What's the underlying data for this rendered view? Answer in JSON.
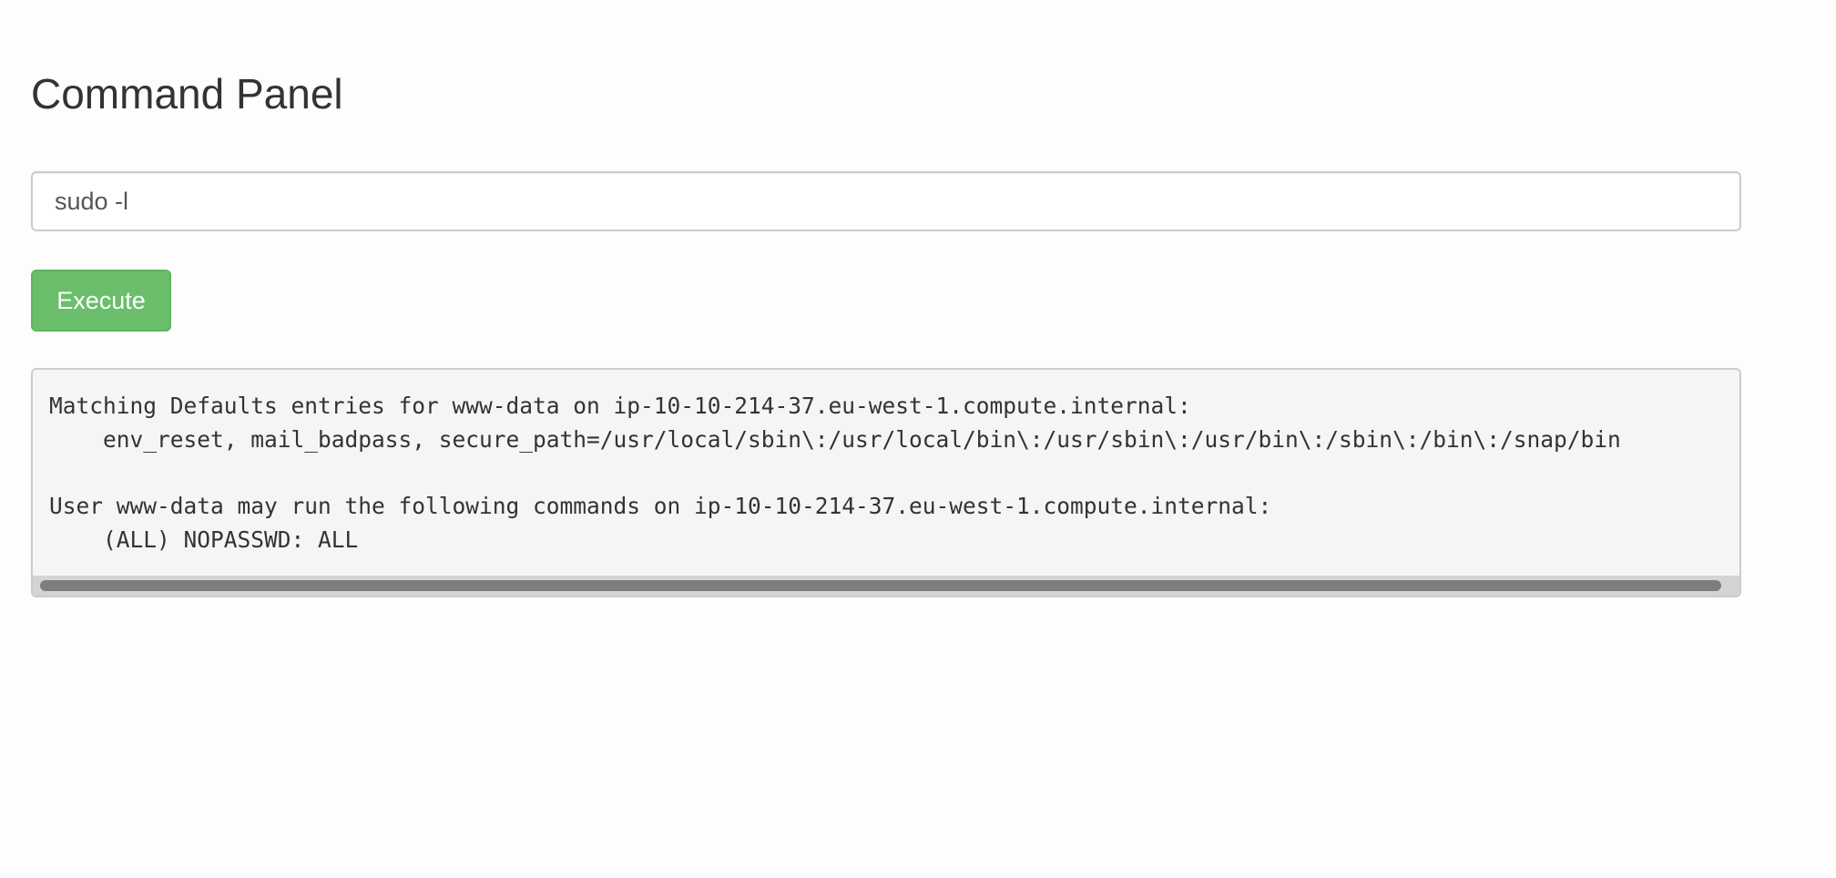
{
  "page": {
    "title": "Command Panel"
  },
  "command": {
    "value": "sudo -l"
  },
  "execute_button": {
    "label": "Execute"
  },
  "output": {
    "lines": [
      "Matching Defaults entries for www-data on ip-10-10-214-37.eu-west-1.compute.internal:",
      "    env_reset, mail_badpass, secure_path=/usr/local/sbin\\:/usr/local/bin\\:/usr/sbin\\:/usr/bin\\:/sbin\\:/bin\\:/snap/bin",
      "",
      "User www-data may run the following commands on ip-10-10-214-37.eu-west-1.compute.internal:",
      "    (ALL) NOPASSWD: ALL"
    ]
  },
  "colors": {
    "execute_button_bg": "#5cb85c",
    "output_bg": "#f5f5f5",
    "page_bg": "#fdfdfd"
  }
}
